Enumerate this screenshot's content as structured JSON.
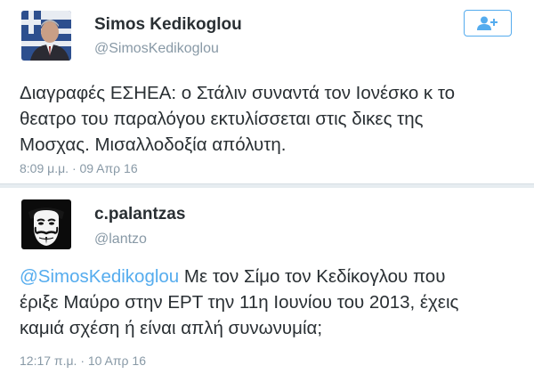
{
  "tweets": [
    {
      "name": "Simos Kedikoglou",
      "handle": "@SimosKedikoglou",
      "text_line1": "Διαγραφές ΕΣΗΕΑ: ο Στάλιν συναντά τον Ιονέσκο κ το",
      "text_line2": "θεατρο του παραλόγου εκτυλίσσεται στις δικες της",
      "text_line3": "Μοσχας. Μισαλλοδοξία απόλυτη.",
      "timestamp": "8:09 μ.μ. · 09 Απρ 16",
      "avatar_icon": "profile-photo-man-suit"
    },
    {
      "name": "c.palantzas",
      "handle": "@lantzo",
      "mention": "@SimosKedikoglou",
      "text_line1_rest": " Με τον Σίμο τον Κεδίκογλου που",
      "text_line2": "έριξε Μαύρο στην ΕΡΤ την 11η Ιουνίου του 2013, έχεις",
      "text_line3": "καμιά σχέση ή είναι απλή συνωνυμία;",
      "timestamp": "12:17 π.μ. · 10 Απρ 16",
      "avatar_icon": "guy-fawkes-mask-icon"
    }
  ],
  "follow_button": {
    "icon": "add-user-icon"
  },
  "colors": {
    "accent": "#55acee",
    "text": "#292f33",
    "secondary": "#8899a6",
    "divider": "#e6ecf0"
  }
}
